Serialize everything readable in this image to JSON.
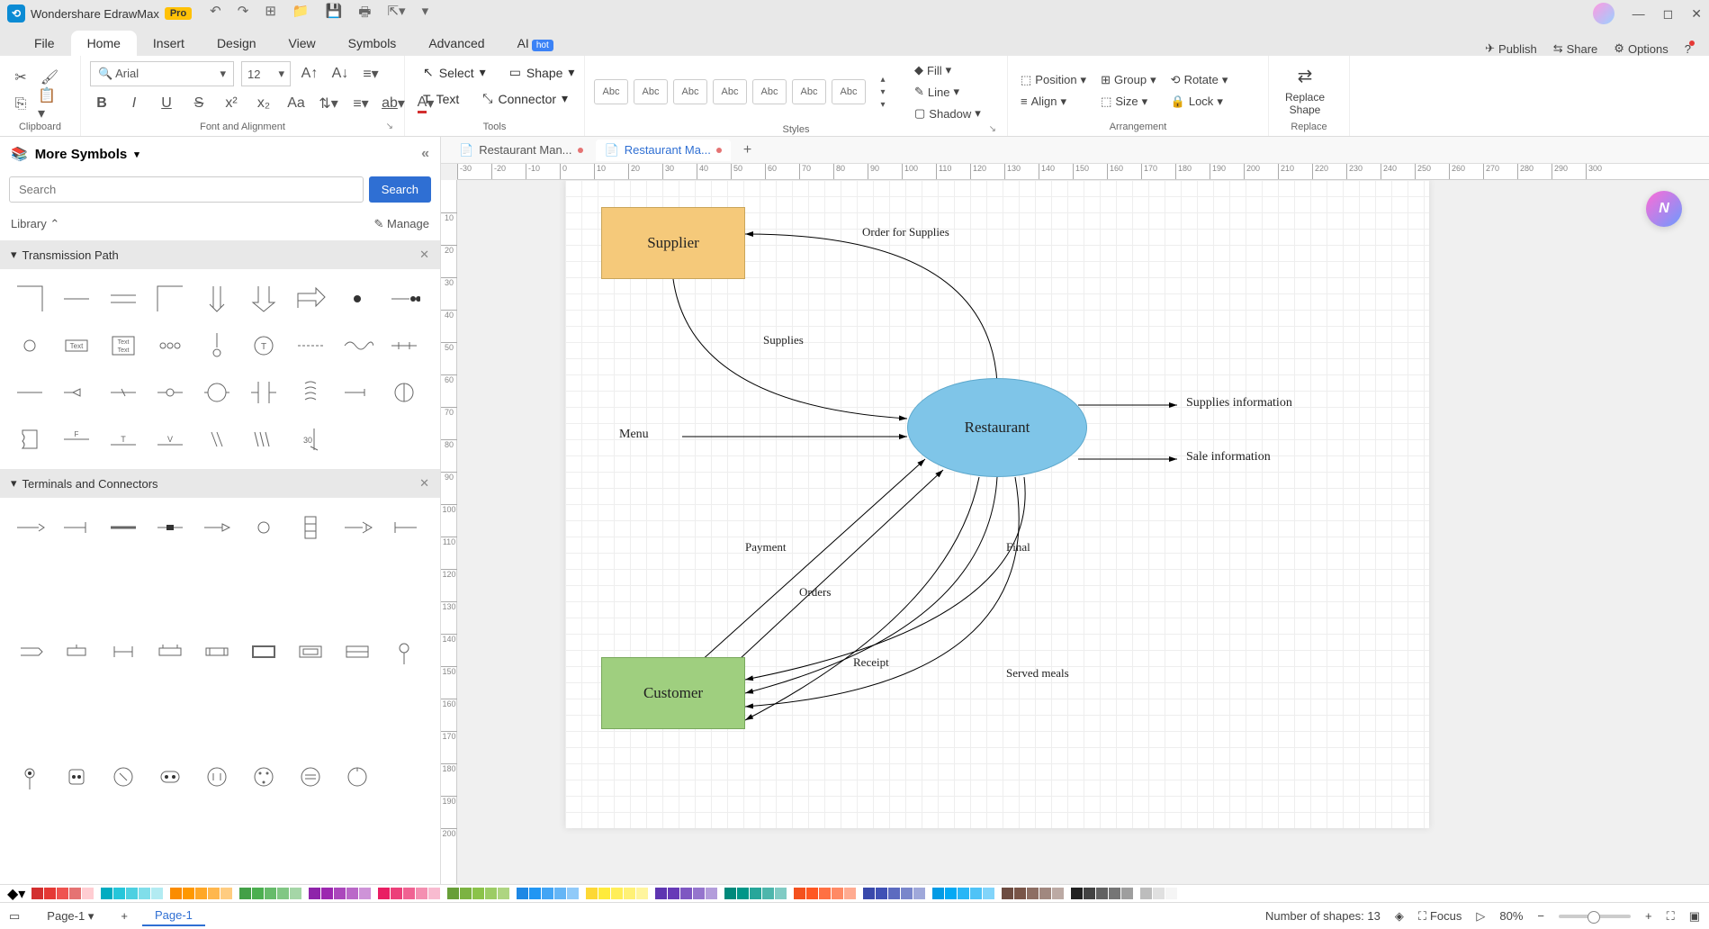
{
  "app": {
    "title": "Wondershare EdrawMax",
    "pro": "Pro"
  },
  "menu": {
    "file": "File",
    "home": "Home",
    "insert": "Insert",
    "design": "Design",
    "view": "View",
    "symbols": "Symbols",
    "advanced": "Advanced",
    "ai": "AI",
    "hot": "hot",
    "publish": "Publish",
    "share": "Share",
    "options": "Options"
  },
  "ribbon": {
    "clipboard": "Clipboard",
    "font_alignment": "Font and Alignment",
    "tools": "Tools",
    "styles": "Styles",
    "arrangement": "Arrangement",
    "replace": "Replace",
    "font_name": "Arial",
    "font_size": "12",
    "select": "Select",
    "text": "Text",
    "shape": "Shape",
    "connector": "Connector",
    "abc": "Abc",
    "fill": "Fill",
    "line": "Line",
    "shadow": "Shadow",
    "position": "Position",
    "align": "Align",
    "group": "Group",
    "size": "Size",
    "rotate": "Rotate",
    "lock": "Lock",
    "replace_shape": "Replace\nShape"
  },
  "panel": {
    "more_symbols": "More Symbols",
    "search_placeholder": "Search",
    "search_btn": "Search",
    "library": "Library",
    "manage": "Manage",
    "section1": "Transmission Path",
    "section2": "Terminals and Connectors"
  },
  "tabs": {
    "tab1": "Restaurant Man...",
    "tab2": "Restaurant Ma..."
  },
  "diagram": {
    "supplier": "Supplier",
    "customer": "Customer",
    "restaurant": "Restaurant",
    "menu": "Menu",
    "supplies_info": "Supplies information",
    "sale_info": "Sale information",
    "order_supplies": "Order for Supplies",
    "supplies": "Supplies",
    "payment": "Payment",
    "orders": "Orders",
    "final": "Final",
    "receipt": "Receipt",
    "served_meals": "Served meals"
  },
  "status": {
    "page1": "Page-1",
    "page1_tab": "Page-1",
    "shapes": "Number of shapes: 13",
    "focus": "Focus",
    "zoom": "80%"
  },
  "colors": [
    "#d32f2f",
    "#e53935",
    "#ef5350",
    "#e57373",
    "#ffcdd2",
    "#00acc1",
    "#26c6da",
    "#4dd0e1",
    "#80deea",
    "#b2ebf2",
    "#fb8c00",
    "#ff9800",
    "#ffa726",
    "#ffb74d",
    "#ffcc80",
    "#43a047",
    "#4caf50",
    "#66bb6a",
    "#81c784",
    "#a5d6a7",
    "#8e24aa",
    "#9c27b0",
    "#ab47bc",
    "#ba68c8",
    "#ce93d8",
    "#e91e63",
    "#ec407a",
    "#f06292",
    "#f48fb1",
    "#f8bbd0",
    "#689f38",
    "#7cb342",
    "#8bc34a",
    "#9ccc65",
    "#aed581",
    "#1e88e5",
    "#2196f3",
    "#42a5f5",
    "#64b5f6",
    "#90caf9",
    "#fdd835",
    "#ffeb3b",
    "#ffee58",
    "#fff176",
    "#fff59d",
    "#5e35b1",
    "#673ab7",
    "#7e57c2",
    "#9575cd",
    "#b39ddb",
    "#00897b",
    "#009688",
    "#26a69a",
    "#4db6ac",
    "#80cbc4",
    "#f4511e",
    "#ff5722",
    "#ff7043",
    "#ff8a65",
    "#ffab91",
    "#3949ab",
    "#3f51b5",
    "#5c6bc0",
    "#7986cb",
    "#9fa8da",
    "#039be5",
    "#03a9f4",
    "#29b6f6",
    "#4fc3f7",
    "#81d4fa",
    "#6d4c41",
    "#795548",
    "#8d6e63",
    "#a1887f",
    "#bcaaa4",
    "#212121",
    "#424242",
    "#616161",
    "#757575",
    "#9e9e9e",
    "#bdbdbd",
    "#e0e0e0",
    "#f5f5f5"
  ]
}
